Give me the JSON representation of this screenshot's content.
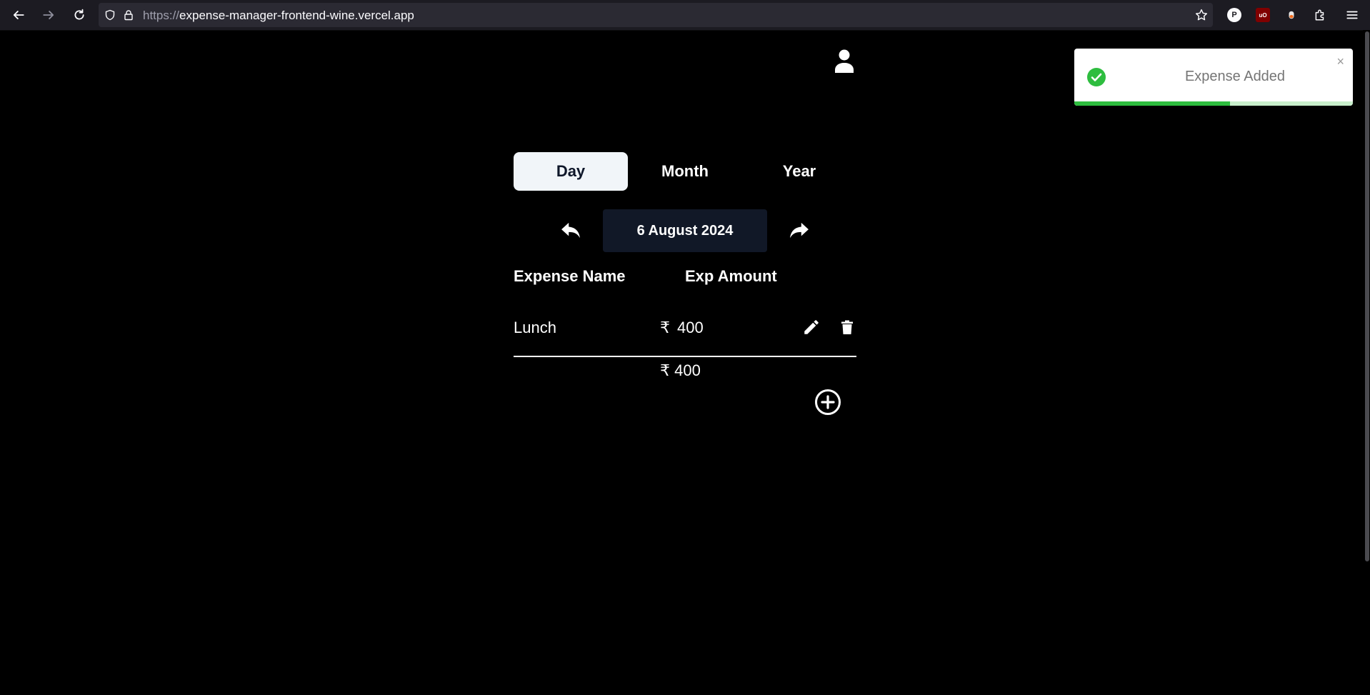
{
  "browser": {
    "url_scheme": "https://",
    "url_host": "expense-manager-frontend-wine.vercel.app",
    "extensions": [
      {
        "name": "p-extension-icon",
        "label": "P",
        "color": "#ffffff"
      },
      {
        "name": "ublock-origin-icon",
        "label": "uO",
        "color": "#800000"
      }
    ]
  },
  "tabs": [
    {
      "label": "Day",
      "active": true
    },
    {
      "label": "Month",
      "active": false
    },
    {
      "label": "Year",
      "active": false
    }
  ],
  "date_nav": {
    "current": "6 August 2024"
  },
  "table": {
    "headers": [
      "Expense Name",
      "Exp Amount"
    ],
    "rows": [
      {
        "name": "Lunch",
        "currency": "₹",
        "amount": "400"
      }
    ],
    "total": "₹ 400"
  },
  "toast": {
    "message": "Expense Added",
    "close_glyph": "×",
    "progress": 0.56,
    "accent": "#2ebd3f"
  },
  "colors": {
    "active_tab_bg": "#f1f5f9",
    "date_box_bg": "#111827",
    "page_bg": "#000000"
  }
}
